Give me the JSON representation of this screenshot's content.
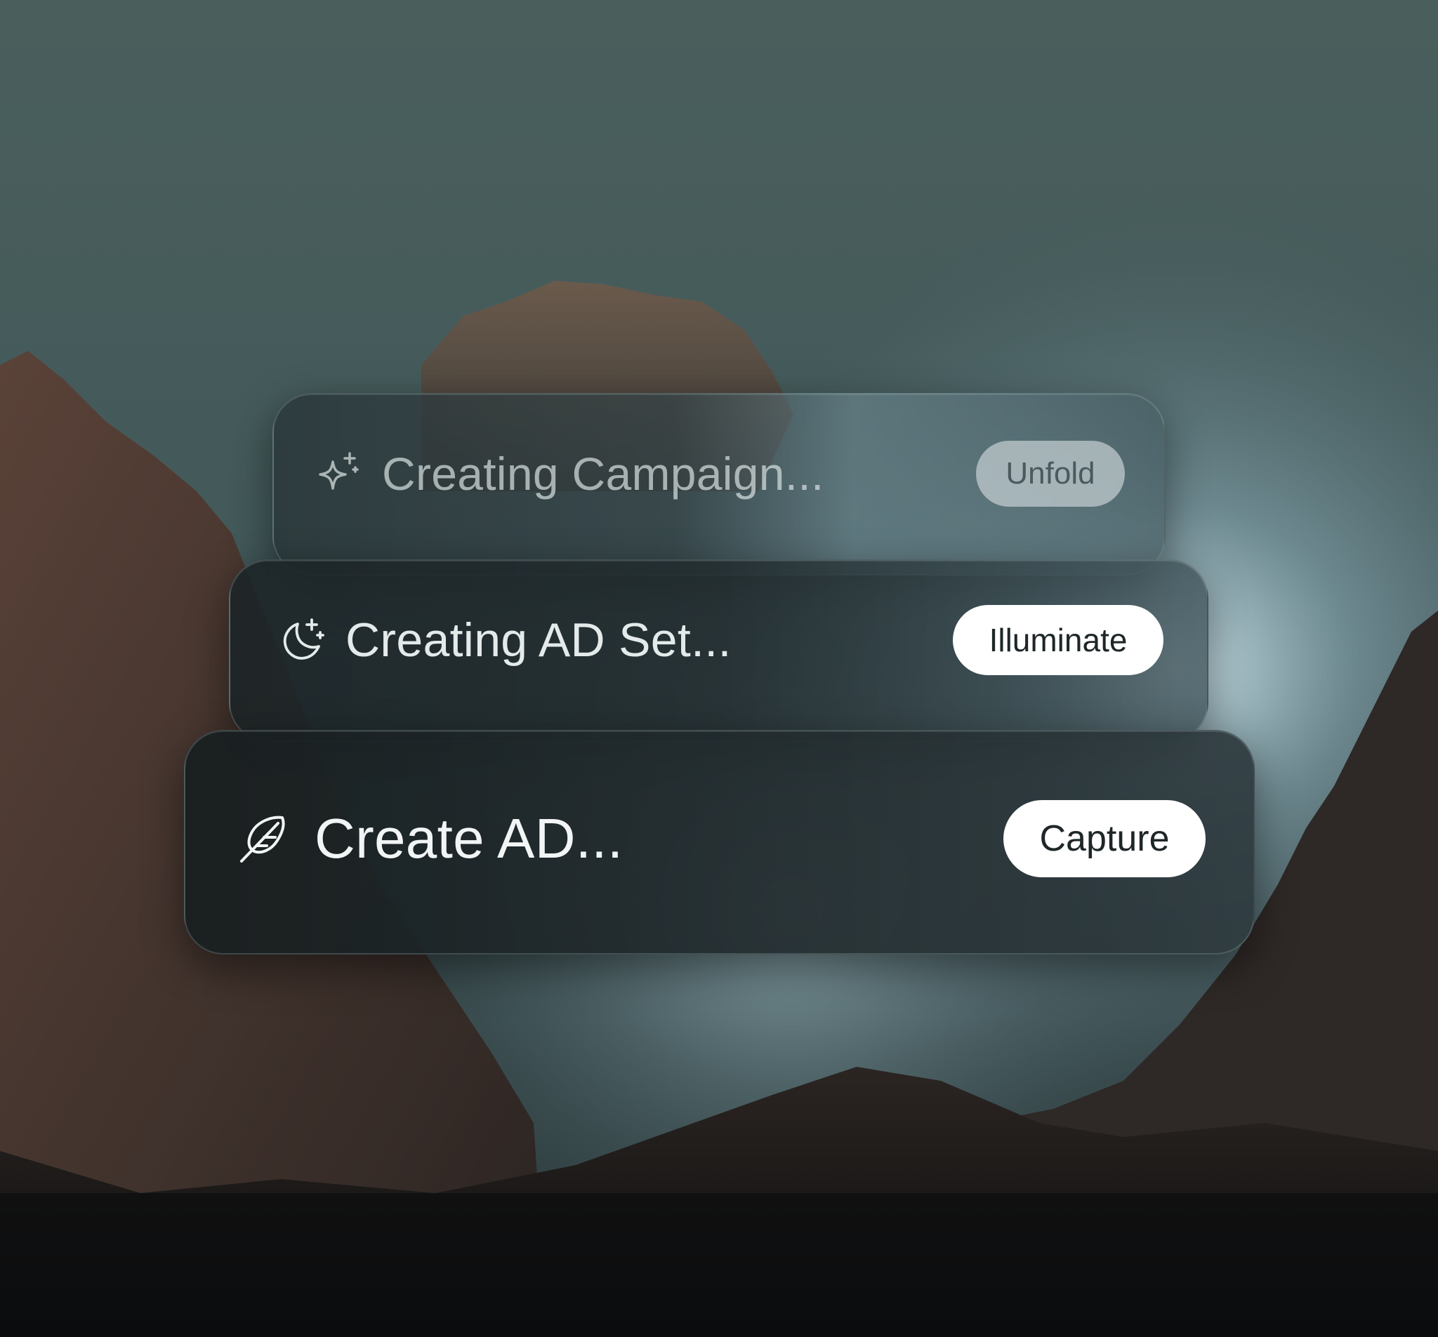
{
  "cards": [
    {
      "label": "Creating Campaign...",
      "button": "Unfold",
      "icon": "sparkle-icon"
    },
    {
      "label": "Creating AD Set...",
      "button": "Illuminate",
      "icon": "moon-stars-icon"
    },
    {
      "label": "Create AD...",
      "button": "Capture",
      "icon": "feather-icon"
    }
  ]
}
